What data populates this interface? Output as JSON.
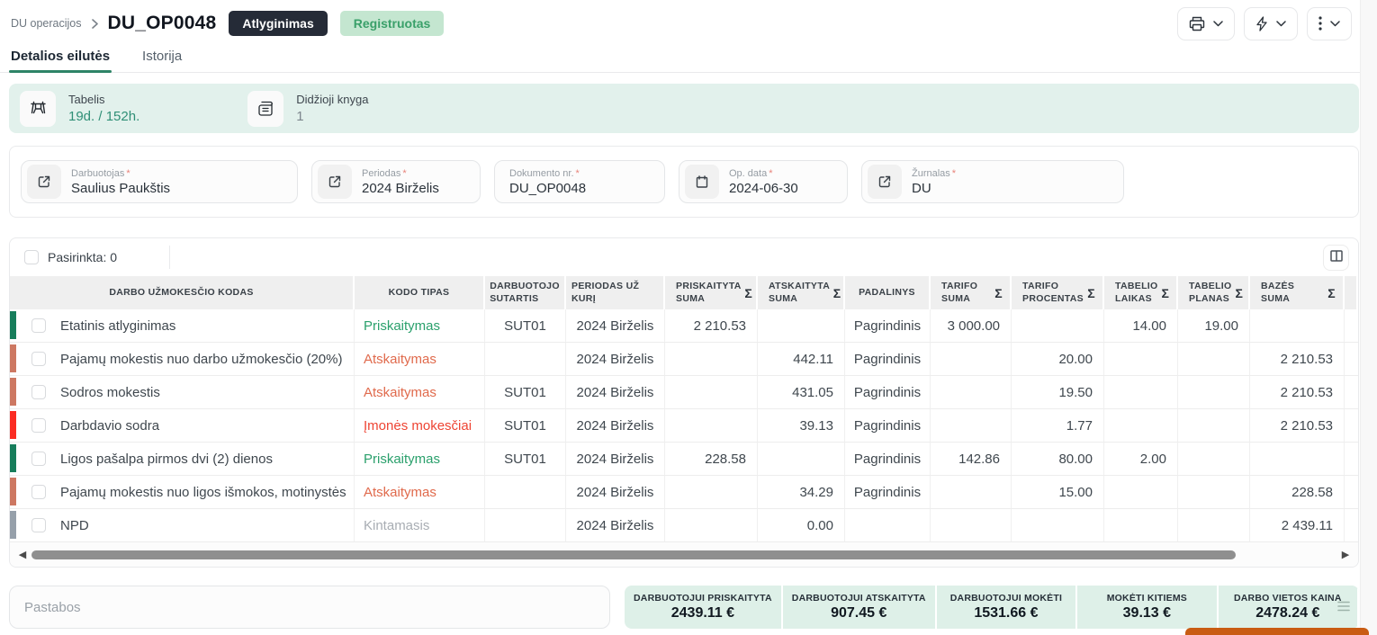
{
  "colors": {
    "accent_green": "#2e8467",
    "badge_dark_bg": "#252b37",
    "badge_green_bg": "#c4e6d0",
    "badge_green_text": "#3aa06a",
    "banner_bg": "#e2f1ec",
    "summary_bg": "#def0e8",
    "stripe_green": "#177d5b",
    "stripe_salmon": "#cd7862",
    "stripe_red": "#fb2c23",
    "stripe_gray": "#96a0aa",
    "type_green": "#2aa06c",
    "type_salmon": "#e06a4c",
    "type_red": "#ee4433",
    "type_gray": "#a8adb3",
    "orange_button": "#c95c13"
  },
  "header": {
    "breadcrumb": "DU operacijos",
    "title": "DU_OP0048",
    "type_badge": "Atlyginimas",
    "status_badge": "Registruotas"
  },
  "tabs": [
    {
      "label": "Detalios eilutės",
      "active": true
    },
    {
      "label": "Istorija",
      "active": false
    }
  ],
  "info_banner": {
    "items": [
      {
        "icon": "timesheet-icon",
        "label": "Tabelis",
        "value": "19d. / 152h."
      },
      {
        "icon": "ledger-icon",
        "label": "Didžioji knyga",
        "value": "1"
      }
    ]
  },
  "required_marker": "*",
  "fields": [
    {
      "icon": "external-link-icon",
      "label": "Darbuotojas",
      "value": "Saulius Paukštis"
    },
    {
      "icon": "external-link-icon",
      "label": "Periodas",
      "value": "2024 Birželis"
    },
    {
      "icon": null,
      "label": "Dokumento nr.",
      "value": "DU_OP0048"
    },
    {
      "icon": "calendar-icon",
      "label": "Op. data",
      "value": "2024-06-30"
    },
    {
      "icon": "external-link-icon",
      "label": "Žurnalas",
      "value": "DU"
    }
  ],
  "table": {
    "selected_label": "Pasirinkta: 0",
    "sum_icon": "Σ",
    "columns": [
      {
        "key": "name",
        "label": "Darbo užmokesčio kodas",
        "sum": false
      },
      {
        "key": "type",
        "label": "Kodo tipas",
        "sum": false
      },
      {
        "key": "contract",
        "label": "Darbuotojo sutartis",
        "sum": false
      },
      {
        "key": "period",
        "label": "Periodas už kurį",
        "sum": false
      },
      {
        "key": "accrued",
        "label": "Priskaityta suma",
        "sum": true
      },
      {
        "key": "deducted",
        "label": "Atskaityta suma",
        "sum": true
      },
      {
        "key": "department",
        "label": "Padalinys",
        "sum": false
      },
      {
        "key": "rate_amount",
        "label": "Tarifo suma",
        "sum": true
      },
      {
        "key": "rate_percent",
        "label": "Tarifo procentas",
        "sum": true
      },
      {
        "key": "time",
        "label": "Tabelio laikas",
        "sum": true
      },
      {
        "key": "plan",
        "label": "Tabelio planas",
        "sum": true
      },
      {
        "key": "base",
        "label": "Bazės suma",
        "sum": true
      },
      {
        "key": "extra",
        "label": "",
        "sum": false
      }
    ],
    "rows": [
      {
        "stripe": "green",
        "name": "Etatinis atlyginimas",
        "type": "Priskaitymas",
        "type_color": "green",
        "contract": "SUT01",
        "period": "2024 Birželis",
        "accrued": "2 210.53",
        "deducted": "",
        "department": "Pagrindinis",
        "rate_amount": "3 000.00",
        "rate_percent": "",
        "time": "14.00",
        "plan": "19.00",
        "base": "",
        "extra": ""
      },
      {
        "stripe": "salmon",
        "name": "Pajamų mokestis nuo darbo užmokesčio (20%)",
        "type": "Atskaitymas",
        "type_color": "salmon",
        "contract": "",
        "period": "2024 Birželis",
        "accrued": "",
        "deducted": "442.11",
        "department": "Pagrindinis",
        "rate_amount": "",
        "rate_percent": "20.00",
        "time": "",
        "plan": "",
        "base": "2 210.53",
        "extra": ""
      },
      {
        "stripe": "salmon",
        "name": "Sodros mokestis",
        "type": "Atskaitymas",
        "type_color": "salmon",
        "contract": "SUT01",
        "period": "2024 Birželis",
        "accrued": "",
        "deducted": "431.05",
        "department": "Pagrindinis",
        "rate_amount": "",
        "rate_percent": "19.50",
        "time": "",
        "plan": "",
        "base": "2 210.53",
        "extra": ""
      },
      {
        "stripe": "red",
        "name": "Darbdavio sodra",
        "type": "Įmonės mokesčiai",
        "type_color": "red",
        "contract": "SUT01",
        "period": "2024 Birželis",
        "accrued": "",
        "deducted": "39.13",
        "department": "Pagrindinis",
        "rate_amount": "",
        "rate_percent": "1.77",
        "time": "",
        "plan": "",
        "base": "2 210.53",
        "extra": ""
      },
      {
        "stripe": "green",
        "name": "Ligos pašalpa pirmos dvi (2) dienos",
        "type": "Priskaitymas",
        "type_color": "green",
        "contract": "SUT01",
        "period": "2024 Birželis",
        "accrued": "228.58",
        "deducted": "",
        "department": "Pagrindinis",
        "rate_amount": "142.86",
        "rate_percent": "80.00",
        "time": "2.00",
        "plan": "",
        "base": "",
        "extra": ""
      },
      {
        "stripe": "salmon",
        "name": "Pajamų mokestis nuo ligos išmokos, motinystės",
        "type": "Atskaitymas",
        "type_color": "salmon",
        "contract": "",
        "period": "2024 Birželis",
        "accrued": "",
        "deducted": "34.29",
        "department": "Pagrindinis",
        "rate_amount": "",
        "rate_percent": "15.00",
        "time": "",
        "plan": "",
        "base": "228.58",
        "extra": ""
      },
      {
        "stripe": "gray",
        "name": "NPD",
        "type": "Kintamasis",
        "type_color": "gray",
        "contract": "",
        "period": "2024 Birželis",
        "accrued": "",
        "deducted": "0.00",
        "department": "",
        "rate_amount": "",
        "rate_percent": "",
        "time": "",
        "plan": "",
        "base": "2 439.11",
        "extra": ""
      }
    ]
  },
  "scrollbar": {
    "left_arrow": "◀",
    "right_arrow": "▶"
  },
  "notes": {
    "placeholder": "Pastabos"
  },
  "summary": {
    "items": [
      {
        "label": "Darbuotojui priskaityta",
        "value": "2439.11 €"
      },
      {
        "label": "Darbuotojui atskaityta",
        "value": "907.45 €"
      },
      {
        "label": "Darbuotojui mokėti",
        "value": "1531.66 €"
      },
      {
        "label": "Mokėti kitiems",
        "value": "39.13 €"
      },
      {
        "label": "Darbo vietos kaina",
        "value": "2478.24 €"
      }
    ]
  }
}
